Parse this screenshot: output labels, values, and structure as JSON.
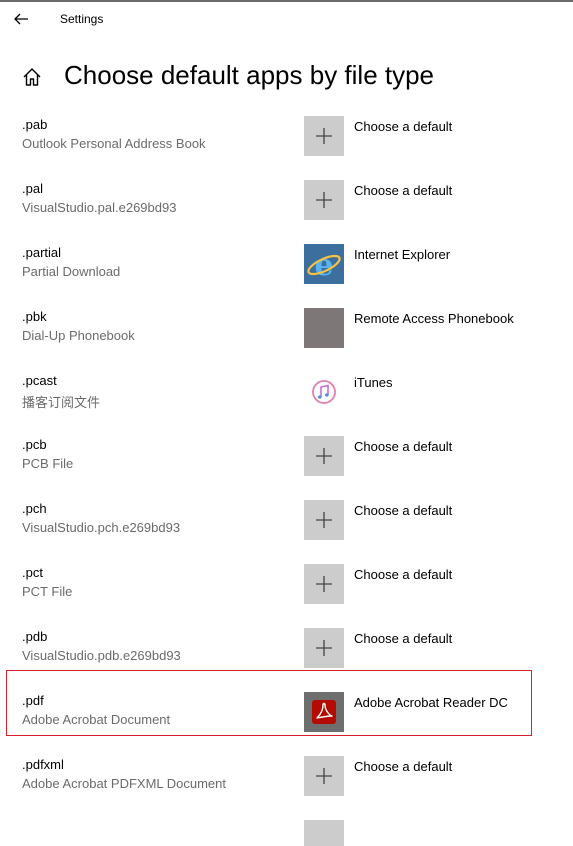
{
  "window": {
    "title": "Settings"
  },
  "page": {
    "title": "Choose default apps by file type"
  },
  "rows": [
    {
      "ext": ".pab",
      "desc": "Outlook Personal Address Book",
      "app": "Choose a default",
      "icon": "plus-icon"
    },
    {
      "ext": ".pal",
      "desc": "VisualStudio.pal.e269bd93",
      "app": "Choose a default",
      "icon": "plus-icon"
    },
    {
      "ext": ".partial",
      "desc": "Partial Download",
      "app": "Internet Explorer",
      "icon": "internet-explorer-icon"
    },
    {
      "ext": ".pbk",
      "desc": "Dial-Up Phonebook",
      "app": "Remote Access Phonebook",
      "icon": "remote-access-phonebook-icon"
    },
    {
      "ext": ".pcast",
      "desc": "播客订阅文件",
      "app": "iTunes",
      "icon": "itunes-icon"
    },
    {
      "ext": ".pcb",
      "desc": "PCB File",
      "app": "Choose a default",
      "icon": "plus-icon"
    },
    {
      "ext": ".pch",
      "desc": "VisualStudio.pch.e269bd93",
      "app": "Choose a default",
      "icon": "plus-icon"
    },
    {
      "ext": ".pct",
      "desc": "PCT File",
      "app": "Choose a default",
      "icon": "plus-icon"
    },
    {
      "ext": ".pdb",
      "desc": "VisualStudio.pdb.e269bd93",
      "app": "Choose a default",
      "icon": "plus-icon"
    },
    {
      "ext": ".pdf",
      "desc": "Adobe Acrobat Document",
      "app": "Adobe Acrobat Reader DC",
      "icon": "adobe-acrobat-icon",
      "highlighted": true
    },
    {
      "ext": ".pdfxml",
      "desc": "Adobe Acrobat PDFXML Document",
      "app": "Choose a default",
      "icon": "plus-icon"
    }
  ],
  "colors": {
    "highlight_border": "#d6212b",
    "tile_bg": "#cccccc",
    "secondary_text": "#6b6b6b"
  }
}
